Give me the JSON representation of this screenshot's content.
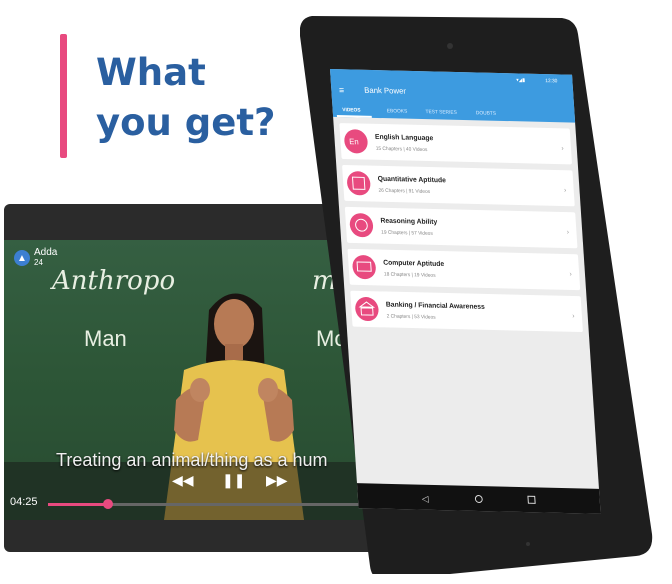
{
  "headline": {
    "line1": "What",
    "line2": "you get?"
  },
  "video": {
    "brand_name": "Adda",
    "brand_sub": "24",
    "board_text_left": "Anthropo",
    "board_text_right": "ma",
    "board_word_left": "Man",
    "board_word_right": "Mo",
    "subtitle": "Treating an animal/thing as a hum",
    "elapsed": "04:25",
    "progress_fraction": 0.19,
    "icons": {
      "rewind": "rewind-icon",
      "pause": "pause-icon",
      "forward": "forward-icon"
    }
  },
  "tablet": {
    "status_time": "12:30",
    "app_title": "Bank Power",
    "tabs": [
      "VIDEOS",
      "EBOOKS",
      "TEST SERIES",
      "DOUBTS"
    ],
    "active_tab": "VIDEOS",
    "courses": [
      {
        "title": "English Language",
        "meta": "15 Chapters | 40 Videos",
        "icon": "En"
      },
      {
        "title": "Quantitative Aptitude",
        "meta": "26 Chapters | 91 Videos",
        "icon": "calculator-icon"
      },
      {
        "title": "Reasoning Ability",
        "meta": "19 Chapters | 57 Videos",
        "icon": "brain-icon"
      },
      {
        "title": "Computer Aptitude",
        "meta": "18 Chapters | 19 Videos",
        "icon": "computer-icon"
      },
      {
        "title": "Banking / Financial Awareness",
        "meta": "2 Chapters | 53 Videos",
        "icon": "bank-icon"
      }
    ],
    "colors": {
      "appbar": "#3d9be0",
      "accent": "#e84a7f",
      "bezel": "#1e1e1e"
    }
  }
}
